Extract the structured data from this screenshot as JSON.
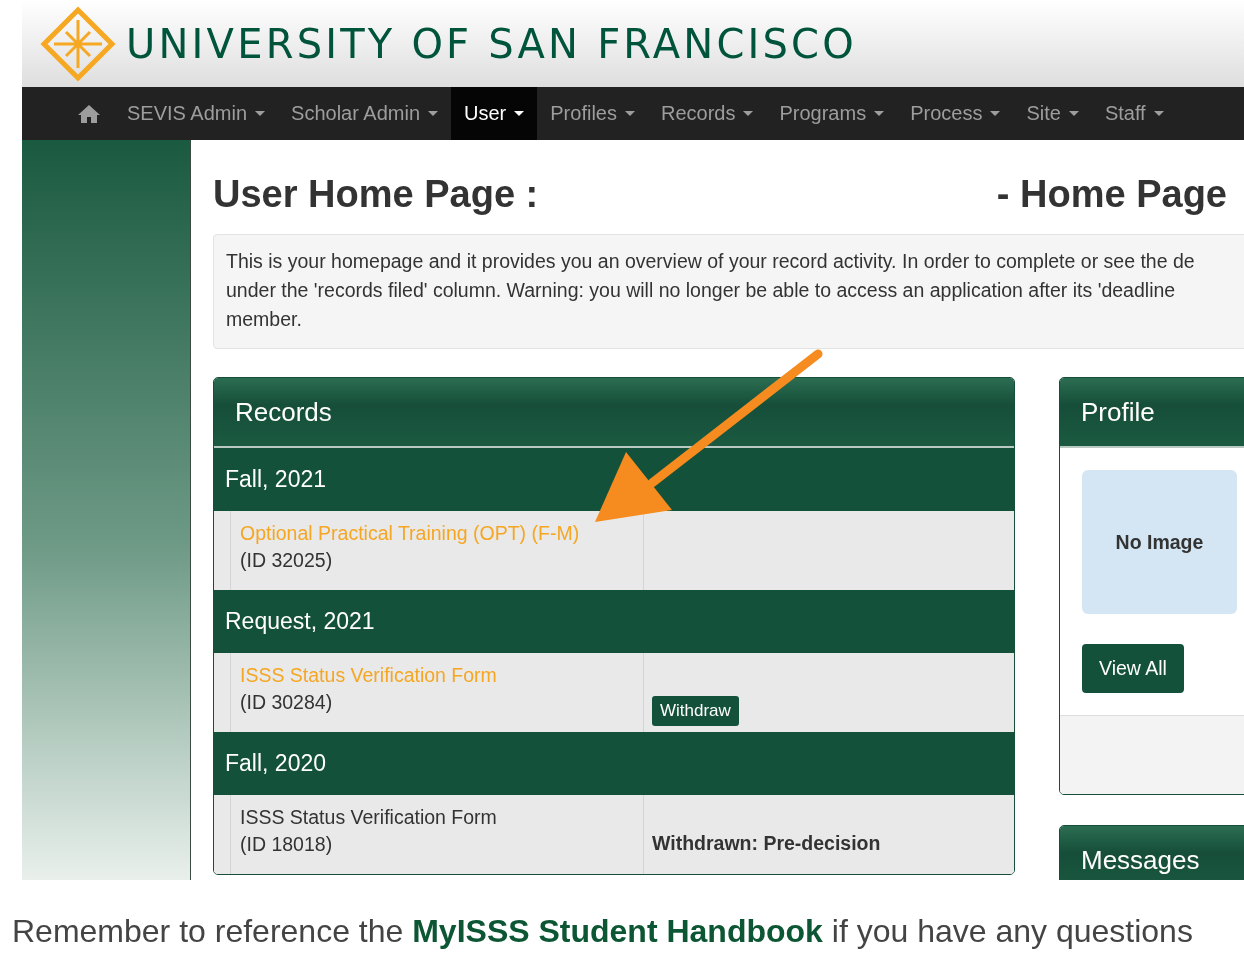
{
  "header": {
    "title": "UNIVERSITY OF SAN FRANCISCO"
  },
  "nav": [
    {
      "label": "SEVIS Admin",
      "selected": false
    },
    {
      "label": "Scholar Admin",
      "selected": false
    },
    {
      "label": "User",
      "selected": true
    },
    {
      "label": "Profiles",
      "selected": false
    },
    {
      "label": "Records",
      "selected": false
    },
    {
      "label": "Programs",
      "selected": false
    },
    {
      "label": "Process",
      "selected": false
    },
    {
      "label": "Site",
      "selected": false
    },
    {
      "label": "Staff",
      "selected": false
    }
  ],
  "page": {
    "title": "User Home Page :",
    "subtitle": "- Home Page"
  },
  "intro": {
    "lines": [
      "This is your homepage and it provides you an overview of your record activity. In order to complete or see the de",
      "under the 'records filed' column. Warning: you will no longer be able to access an application after its 'deadline",
      "member."
    ]
  },
  "records": {
    "title": "Records",
    "groups": [
      {
        "label": "Fall, 2021",
        "items": [
          {
            "name": "Optional Practical Training (OPT) (F-M)",
            "linked": true,
            "id": "(ID 32025)"
          }
        ]
      },
      {
        "label": "Request, 2021",
        "items": [
          {
            "name": "ISSS Status Verification Form",
            "linked": true,
            "id": "(ID 30284)",
            "action": {
              "kind": "button",
              "label": "Withdraw"
            }
          }
        ]
      },
      {
        "label": "Fall, 2020",
        "items": [
          {
            "name": "ISSS Status Verification Form",
            "linked": false,
            "id": "(ID 18018)",
            "action": {
              "kind": "status",
              "label": "Withdrawn: Pre-decision"
            }
          }
        ]
      }
    ]
  },
  "profile": {
    "title": "Profile",
    "placeholder": "No Image",
    "button": "View All"
  },
  "messages": {
    "title": "Messages"
  },
  "footer": {
    "lines": [
      [
        {
          "text": "Remember to reference the ",
          "kind": "text"
        },
        {
          "text": "MyISSS Student Handbook",
          "kind": "link"
        },
        {
          "text": " if you have any questions",
          "kind": "text"
        }
      ]
    ]
  }
}
